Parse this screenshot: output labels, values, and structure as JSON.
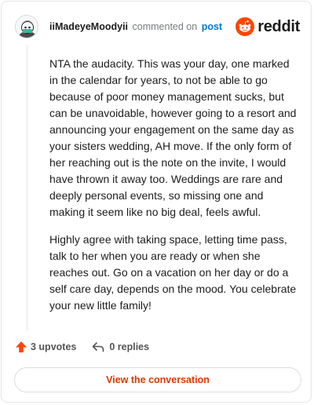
{
  "comment": {
    "username": "iiMadeyeMoodyii",
    "commented_on": "commented on",
    "post_link": "post",
    "paragraphs": [
      "NTA the audacity. This was your day, one marked in the calendar for years, to not be able to go because of poor money management sucks, but can be unavoidable, however going to a resort and announcing your engagement on the same day as your sisters wedding, AH move. If the only form of her reaching out is the note on the invite, I would have thrown it away too. Weddings are rare and deeply personal events, so missing one and making it seem like no big deal, feels awful.",
      "Highly agree with taking space, letting time pass, talk to her when you are ready or when she reaches out. Go on a vacation on her day or do a self care day, depends on the mood. You celebrate your new little family!"
    ]
  },
  "brand": {
    "wordmark": "reddit",
    "icon": "reddit-snoo-icon",
    "color": "#ff4500"
  },
  "actions": {
    "upvotes": "3 upvotes",
    "upvote_icon": "upvote-arrow-icon",
    "replies": "0 replies",
    "reply_icon": "reply-arrow-icon",
    "upvote_color": "#ff4500"
  },
  "cta": {
    "label": "View the conversation",
    "color": "#d93a00"
  }
}
